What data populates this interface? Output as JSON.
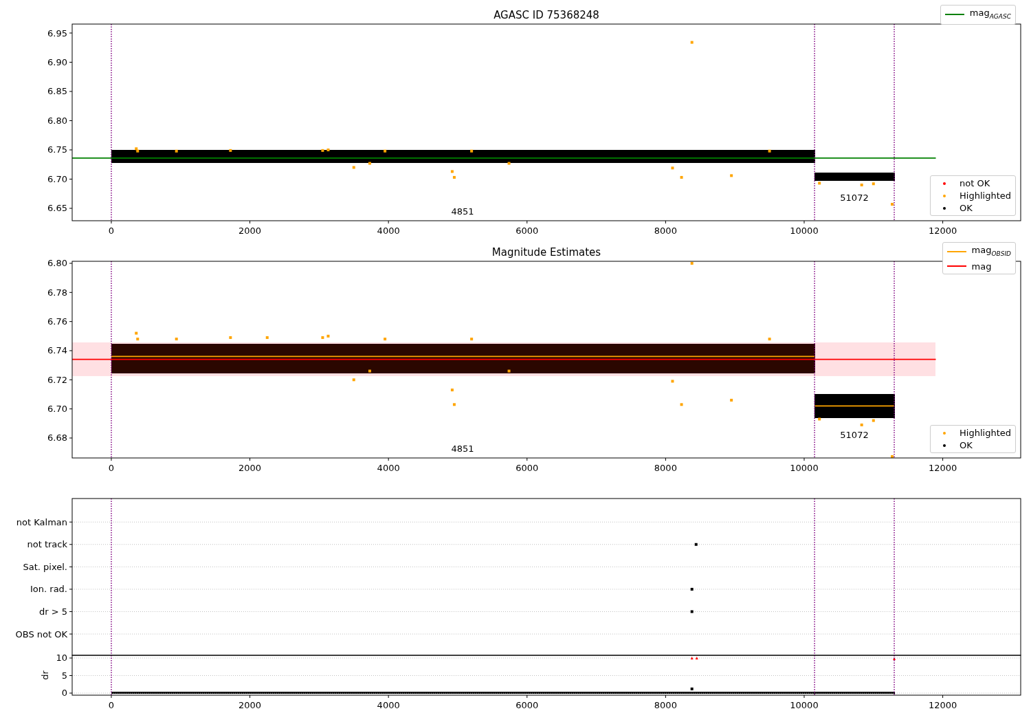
{
  "panels": [
    {
      "kind": "magnitude",
      "title": "AGASC ID 75368248",
      "chart_data": {
        "type": "scatter",
        "xlim": [
          -565,
          13125
        ],
        "ylim": [
          6.6288,
          6.9653
        ],
        "xticks": [
          {
            "value": 0,
            "label": "0"
          },
          {
            "value": 2000,
            "label": "2000"
          },
          {
            "value": 4000,
            "label": "4000"
          },
          {
            "value": 6000,
            "label": "6000"
          },
          {
            "value": 8000,
            "label": "8000"
          },
          {
            "value": 10000,
            "label": "10000"
          },
          {
            "value": 12000,
            "label": "12000"
          }
        ],
        "yticks": [
          {
            "value": 6.65,
            "label": "6.65"
          },
          {
            "value": 6.7,
            "label": "6.70"
          },
          {
            "value": 6.75,
            "label": "6.75"
          },
          {
            "value": 6.8,
            "label": "6.80"
          },
          {
            "value": 6.85,
            "label": "6.85"
          },
          {
            "value": 6.9,
            "label": "6.90"
          },
          {
            "value": 6.95,
            "label": "6.95"
          }
        ],
        "series": [
          {
            "type": "line",
            "color": "#008000",
            "x": [
              -565,
              11900
            ],
            "values": [
              6.736,
              6.736
            ]
          },
          {
            "color": "#ffa500",
            "x": [
              360,
              380,
              940,
              1720,
              3050,
              3130,
              3500,
              3730,
              3950,
              4920,
              4950,
              5200,
              5740,
              8100,
              8230,
              8380,
              8950,
              9500,
              10220,
              10830,
              11000,
              11270
            ],
            "values": [
              6.752,
              6.748,
              6.748,
              6.749,
              6.749,
              6.75,
              6.72,
              6.727,
              6.748,
              6.713,
              6.703,
              6.748,
              6.727,
              6.719,
              6.703,
              6.934,
              6.706,
              6.748,
              6.693,
              6.69,
              6.692,
              6.657
            ]
          }
        ],
        "ref_lines": [
          {
            "axis": "x",
            "value": 0,
            "color": "#800080"
          },
          {
            "axis": "x",
            "value": 10150,
            "color": "#800080"
          },
          {
            "axis": "x",
            "value": 11300,
            "color": "#800080"
          }
        ],
        "annotations": [
          "4851",
          "51072"
        ]
      },
      "legends": [
        {
          "items": [
            {
              "kind": "line",
              "label": "mag$_{AGASC}$",
              "color": "#008000"
            }
          ]
        },
        {
          "items": [
            {
              "kind": "marker",
              "label": "not OK",
              "color": "#ff0000"
            },
            {
              "kind": "marker",
              "label": "Highlighted",
              "color": "#ffa500"
            },
            {
              "kind": "marker",
              "label": "OK",
              "color": "#000000"
            }
          ]
        }
      ]
    },
    {
      "kind": "magnitude",
      "title": "Magnitude Estimates",
      "chart_data": {
        "type": "scatter",
        "xlim": [
          -565,
          13125
        ],
        "ylim": [
          6.6663,
          6.8014
        ],
        "xticks": [
          {
            "value": 0,
            "label": "0"
          },
          {
            "value": 2000,
            "label": "2000"
          },
          {
            "value": 4000,
            "label": "4000"
          },
          {
            "value": 6000,
            "label": "6000"
          },
          {
            "value": 8000,
            "label": "8000"
          },
          {
            "value": 10000,
            "label": "10000"
          },
          {
            "value": 12000,
            "label": "12000"
          }
        ],
        "yticks": [
          {
            "value": 6.68,
            "label": "6.68"
          },
          {
            "value": 6.7,
            "label": "6.70"
          },
          {
            "value": 6.72,
            "label": "6.72"
          },
          {
            "value": 6.74,
            "label": "6.74"
          },
          {
            "value": 6.76,
            "label": "6.76"
          },
          {
            "value": 6.78,
            "label": "6.78"
          },
          {
            "value": 6.8,
            "label": "6.80"
          }
        ],
        "series": [
          {
            "type": "line",
            "color": "#ffa500",
            "x": [
              0,
              10150
            ],
            "values": [
              6.736,
              6.736
            ]
          },
          {
            "type": "line",
            "color": "#ffa500",
            "x": [
              10150,
              11300
            ],
            "values": [
              6.702,
              6.702
            ]
          },
          {
            "type": "line",
            "color": "#ff0000",
            "x": [
              -565,
              11900
            ],
            "values": [
              6.734,
              6.734
            ]
          },
          {
            "color": "#ffa500",
            "x": [
              360,
              380,
              940,
              1720,
              2250,
              3050,
              3130,
              3500,
              3730,
              3950,
              4920,
              4950,
              5200,
              5740,
              8100,
              8230,
              8380,
              8950,
              9500,
              10220,
              10830,
              11000,
              11270
            ],
            "values": [
              6.752,
              6.748,
              6.748,
              6.749,
              6.749,
              6.749,
              6.75,
              6.72,
              6.726,
              6.748,
              6.713,
              6.703,
              6.748,
              6.726,
              6.719,
              6.703,
              6.8,
              6.706,
              6.748,
              6.693,
              6.689,
              6.692,
              6.667
            ]
          }
        ],
        "ref_lines": [
          {
            "axis": "x",
            "value": 0,
            "color": "#800080"
          },
          {
            "axis": "x",
            "value": 10150,
            "color": "#800080"
          },
          {
            "axis": "x",
            "value": 11300,
            "color": "#800080"
          }
        ],
        "annotations": [
          "4851",
          "51072"
        ]
      },
      "legends": [
        {
          "items": [
            {
              "kind": "line",
              "label": "mag$_{OBSID}$",
              "color": "#ffa500"
            },
            {
              "kind": "line",
              "label": "mag",
              "color": "#ff0000"
            }
          ]
        },
        {
          "items": [
            {
              "kind": "marker",
              "label": "Highlighted",
              "color": "#ffa500"
            },
            {
              "kind": "marker",
              "label": "OK",
              "color": "#000000"
            }
          ]
        }
      ]
    },
    {
      "kind": "flags",
      "chart_data": {
        "type": "scatter",
        "orientation": "horizontal",
        "xlim": [
          -565,
          13125
        ],
        "grid": true,
        "categories": [
          "not Kalman",
          "not track",
          "Sat. pixel.",
          "Ion. rad.",
          "dr > 5",
          "OBS not OK"
        ],
        "series": [
          {
            "color": "#000000",
            "values": [
              null,
              8440,
              null,
              8380,
              8380,
              null
            ]
          }
        ],
        "ref_lines": [
          {
            "axis": "x",
            "value": 0,
            "color": "#800080"
          },
          {
            "axis": "x",
            "value": 10150,
            "color": "#800080"
          },
          {
            "axis": "x",
            "value": 11300,
            "color": "#800080"
          }
        ]
      },
      "dr_axes": {
        "chart_data": {
          "type": "scatter",
          "xlim": [
            -565,
            13125
          ],
          "ylim": [
            -0.59,
            10.78
          ],
          "grid": true,
          "ylabel": "dr",
          "xticks": [
            {
              "value": 0,
              "label": "0"
            },
            {
              "value": 2000,
              "label": "2000"
            },
            {
              "value": 4000,
              "label": "4000"
            },
            {
              "value": 6000,
              "label": "6000"
            },
            {
              "value": 8000,
              "label": "8000"
            },
            {
              "value": 10000,
              "label": "10000"
            },
            {
              "value": 12000,
              "label": "12000"
            }
          ],
          "yticks": [
            {
              "value": 0,
              "label": "0"
            },
            {
              "value": 5,
              "label": "5"
            },
            {
              "value": 10,
              "label": "10"
            }
          ],
          "series": [
            {
              "color": "#ff0000",
              "marker": "triangle",
              "x": [
                8380,
                8450,
                11300
              ],
              "values": [
                10,
                10,
                9.8
              ]
            },
            {
              "color": "#000000",
              "x": [
                8380
              ],
              "values": [
                1.2
              ]
            }
          ],
          "ref_lines": [
            {
              "axis": "x",
              "value": 0,
              "color": "#800080"
            },
            {
              "axis": "x",
              "value": 10150,
              "color": "#800080"
            },
            {
              "axis": "x",
              "value": 11300,
              "color": "#800080"
            }
          ]
        }
      }
    }
  ]
}
